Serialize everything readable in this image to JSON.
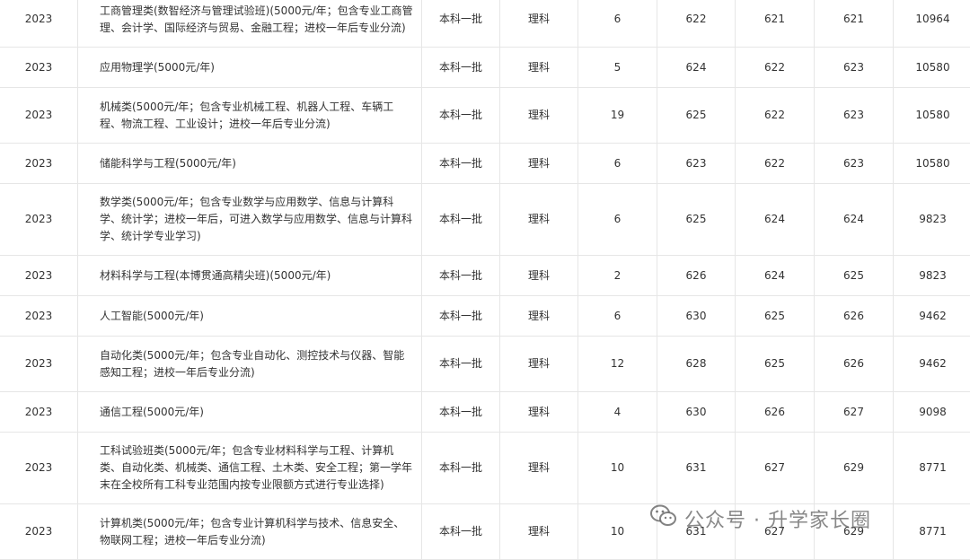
{
  "rows": [
    {
      "year": "2023",
      "major": "工商管理类(数智经济与管理试验班)(5000元/年；包含专业工商管理、会计学、国际经济与贸易、金融工程；进校一年后专业分流)",
      "batch": "本科一批",
      "category": "理科",
      "plan": "6",
      "max": "622",
      "min": "621",
      "avg": "621",
      "rank": "10964"
    },
    {
      "year": "2023",
      "major": "应用物理学(5000元/年)",
      "batch": "本科一批",
      "category": "理科",
      "plan": "5",
      "max": "624",
      "min": "622",
      "avg": "623",
      "rank": "10580"
    },
    {
      "year": "2023",
      "major": "机械类(5000元/年；包含专业机械工程、机器人工程、车辆工程、物流工程、工业设计；进校一年后专业分流)",
      "batch": "本科一批",
      "category": "理科",
      "plan": "19",
      "max": "625",
      "min": "622",
      "avg": "623",
      "rank": "10580"
    },
    {
      "year": "2023",
      "major": "储能科学与工程(5000元/年)",
      "batch": "本科一批",
      "category": "理科",
      "plan": "6",
      "max": "623",
      "min": "622",
      "avg": "623",
      "rank": "10580"
    },
    {
      "year": "2023",
      "major": "数学类(5000元/年；包含专业数学与应用数学、信息与计算科学、统计学；进校一年后，可进入数学与应用数学、信息与计算科学、统计学专业学习)",
      "batch": "本科一批",
      "category": "理科",
      "plan": "6",
      "max": "625",
      "min": "624",
      "avg": "624",
      "rank": "9823"
    },
    {
      "year": "2023",
      "major": "材料科学与工程(本博贯通高精尖班)(5000元/年)",
      "batch": "本科一批",
      "category": "理科",
      "plan": "2",
      "max": "626",
      "min": "624",
      "avg": "625",
      "rank": "9823"
    },
    {
      "year": "2023",
      "major": "人工智能(5000元/年)",
      "batch": "本科一批",
      "category": "理科",
      "plan": "6",
      "max": "630",
      "min": "625",
      "avg": "626",
      "rank": "9462"
    },
    {
      "year": "2023",
      "major": "自动化类(5000元/年；包含专业自动化、测控技术与仪器、智能感知工程；进校一年后专业分流)",
      "batch": "本科一批",
      "category": "理科",
      "plan": "12",
      "max": "628",
      "min": "625",
      "avg": "626",
      "rank": "9462"
    },
    {
      "year": "2023",
      "major": "通信工程(5000元/年)",
      "batch": "本科一批",
      "category": "理科",
      "plan": "4",
      "max": "630",
      "min": "626",
      "avg": "627",
      "rank": "9098"
    },
    {
      "year": "2023",
      "major": "工科试验班类(5000元/年；包含专业材料科学与工程、计算机类、自动化类、机械类、通信工程、土木类、安全工程；第一学年末在全校所有工科专业范围内按专业限额方式进行专业选择)",
      "batch": "本科一批",
      "category": "理科",
      "plan": "10",
      "max": "631",
      "min": "627",
      "avg": "629",
      "rank": "8771"
    },
    {
      "year": "2023",
      "major": "计算机类(5000元/年；包含专业计算机科学与技术、信息安全、物联网工程；进校一年后专业分流)",
      "batch": "本科一批",
      "category": "理科",
      "plan": "10",
      "max": "631",
      "min": "627",
      "avg": "629",
      "rank": "8771"
    }
  ],
  "watermark": {
    "text": "公众号 · 升学家长圈",
    "icon": "wechat-icon"
  }
}
